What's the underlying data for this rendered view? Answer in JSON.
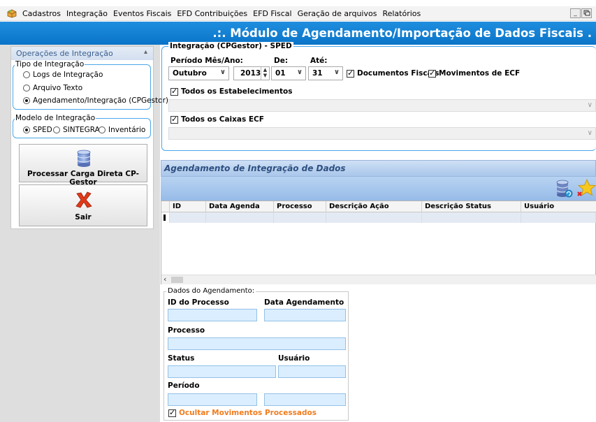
{
  "menu": {
    "items": [
      "Cadastros",
      "Integração",
      "Eventos Fiscais",
      "EFD Contribuições",
      "EFD Fiscal",
      "Geração de arquivos",
      "Relatórios"
    ],
    "window_buttons": [
      "_",
      "🗗"
    ]
  },
  "title": ".:. Módulo de Agendamento/Importação de Dados Fiscais .",
  "left_panel": {
    "header": "Operações de Integração",
    "tipo_group": {
      "legend": "Tipo de Integração",
      "options": [
        "Logs de Integração",
        "Arquivo Texto",
        "Agendamento/Integração (CPGestor)"
      ],
      "selected_index": 2
    },
    "modelo_group": {
      "legend": "Modelo de Integração",
      "options": [
        "SPED",
        "SINTEGRA",
        "Inventário"
      ],
      "selected_index": 0
    },
    "process_button": "Processar Carga Direta CP-Gestor",
    "exit_button": "Sair"
  },
  "integration": {
    "legend": "Integração (CPGestor) - SPED",
    "period_label": "Período Mês/Ano:",
    "month": "Outubro",
    "year": "2013",
    "from_label": "De:",
    "from_day": "01",
    "to_label": "Até:",
    "to_day": "31",
    "chk_docs": "Documentos Fiscais",
    "chk_ecf": "Movimentos de ECF",
    "chk_estab": "Todos os Estabelecimentos",
    "chk_caixas": "Todos os Caixas ECF"
  },
  "schedule": {
    "header": "Agendamento de Integração de Dados",
    "columns": [
      "ID",
      "Data Agenda",
      "Processo",
      "Descrição Ação",
      "Descrição Status",
      "Usuário"
    ]
  },
  "details": {
    "legend": "Dados do Agendamento:",
    "id_label": "ID do Processo",
    "date_label": "Data Agendamento",
    "process_label": "Processo",
    "status_label": "Status",
    "user_label": "Usuário",
    "period_label": "Período",
    "hide_processed": "Ocultar Movimentos Processados"
  },
  "colors": {
    "title_bar": "#0a74c8",
    "group_border": "#4aa6ea",
    "field_fill": "#dbeeff",
    "orange_text": "#f07c1e",
    "exit_icon": "#e03a1a"
  }
}
